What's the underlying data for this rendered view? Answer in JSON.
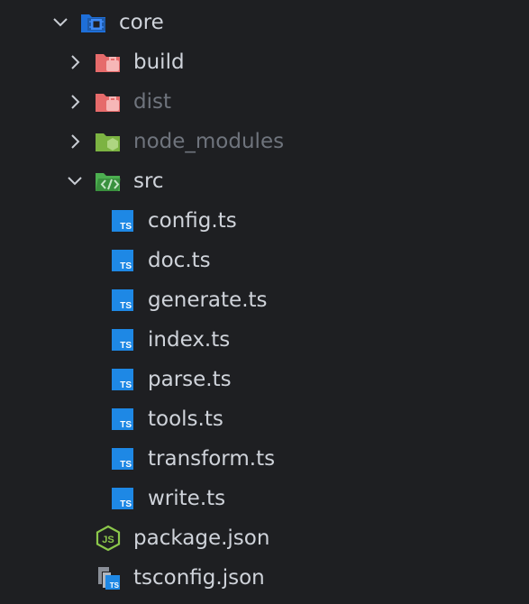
{
  "explorer": {
    "root": {
      "label": "core",
      "icon": "folder-open-icon",
      "state": "expanded"
    },
    "items": [
      {
        "label": "build",
        "icon": "folder-build-icon",
        "state": "collapsed"
      },
      {
        "label": "dist",
        "icon": "folder-dist-icon",
        "state": "collapsed",
        "dimmed": true
      },
      {
        "label": "node_modules",
        "icon": "folder-node-icon",
        "state": "collapsed",
        "dimmed": true
      },
      {
        "label": "src",
        "icon": "folder-src-open-icon",
        "state": "expanded"
      }
    ],
    "src_files": [
      {
        "label": "config.ts",
        "icon": "typescript-icon"
      },
      {
        "label": "doc.ts",
        "icon": "typescript-icon"
      },
      {
        "label": "generate.ts",
        "icon": "typescript-icon"
      },
      {
        "label": "index.ts",
        "icon": "typescript-icon"
      },
      {
        "label": "parse.ts",
        "icon": "typescript-icon"
      },
      {
        "label": "tools.ts",
        "icon": "typescript-icon"
      },
      {
        "label": "transform.ts",
        "icon": "typescript-icon"
      },
      {
        "label": "write.ts",
        "icon": "typescript-icon"
      }
    ],
    "root_files": [
      {
        "label": "package.json",
        "icon": "nodejs-icon"
      },
      {
        "label": "tsconfig.json",
        "icon": "tsconfig-icon"
      }
    ]
  },
  "colors": {
    "background": "#1e1f22",
    "text": "#cfd3da",
    "dimmed_text": "#6f747d",
    "folder_red": "#e66b6b",
    "folder_green": "#7cb342",
    "folder_blue": "#42a5f5",
    "ts_blue": "#1e88e5"
  }
}
